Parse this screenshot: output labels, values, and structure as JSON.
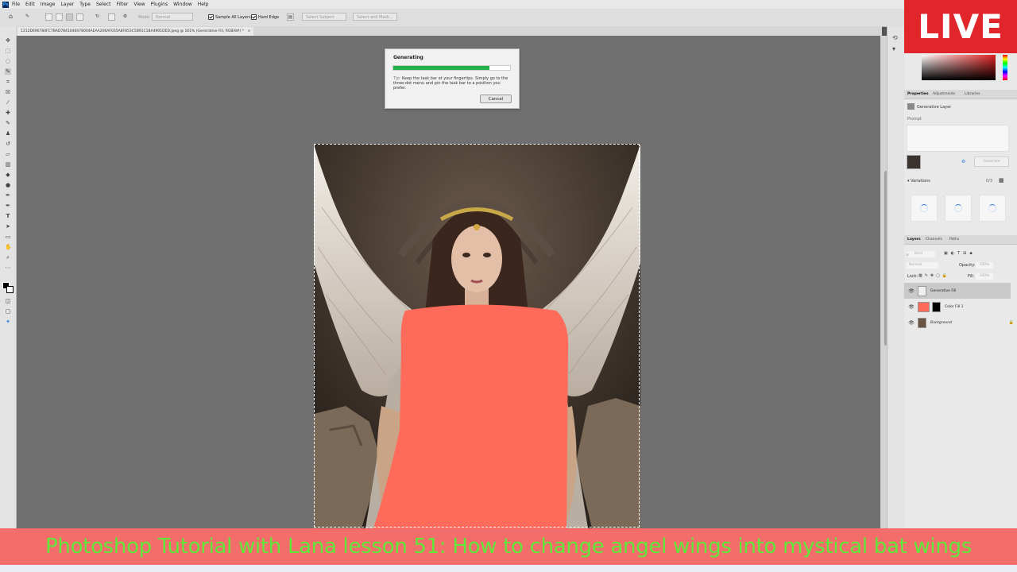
{
  "menu": {
    "items": [
      "File",
      "Edit",
      "Image",
      "Layer",
      "Type",
      "Select",
      "Filter",
      "View",
      "Plugins",
      "Window",
      "Help"
    ]
  },
  "options_bar": {
    "mode_label": "Mode:",
    "mode_value": "Normal",
    "sample_all_layers": "Sample All Layers",
    "hard_edge": "Hard Edge",
    "select_subject": "Select Subject",
    "select_and_mask": "Select and Mask..."
  },
  "document": {
    "tab_title": "1212D696784FC7BAD7841046078004AEAA206AF035A8F853C5B91C1BA4901DED.jpeg @ 161% (Generative Fill, RGB/8#) *",
    "tab_close": "×"
  },
  "dialog": {
    "title": "Generating",
    "progress": 0.82,
    "tip_prefix": "Tip:",
    "tip_text": "Keep the task bar at your fingertips. Simply go to the three-dot menu and pin the task bar to a position you prefer.",
    "cancel_label": "Cancel"
  },
  "live_badge": "LIVE",
  "properties": {
    "tabs": [
      "Properties",
      "Adjustments",
      "Libraries"
    ],
    "layer_type": "Generative Layer",
    "prompt_label": "Prompt",
    "generate_label": "Generate",
    "variations_label": "Variations",
    "variations_count": "0/3"
  },
  "layers": {
    "tabs": [
      "Layers",
      "Channels",
      "Paths"
    ],
    "filter_placeholder": "Kind",
    "blend_mode": "Normal",
    "opacity_label": "Opacity:",
    "opacity_value": "100%",
    "lock_label": "Lock:",
    "fill_label": "Fill:",
    "fill_value": "100%",
    "items": [
      {
        "name": "Generative Fill",
        "selected": true
      },
      {
        "name": "Color Fill 1",
        "selected": false
      },
      {
        "name": "Background",
        "selected": false
      }
    ]
  },
  "banner": {
    "text": "Photoshop Tutorial with Lana lesson 51: How to change angel wings into mystical bat wings"
  },
  "colors": {
    "live_red": "#e0262b",
    "banner_bg": "#f36e6b",
    "banner_text": "#5fe83a",
    "fill_color": "#ff6b5a",
    "progress_green": "#22b14c"
  }
}
